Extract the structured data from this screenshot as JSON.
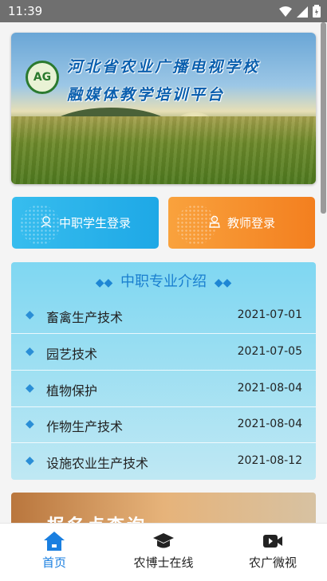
{
  "status_bar": {
    "time": "11:39"
  },
  "banner": {
    "logo_text": "AG",
    "title_line1": "河北省农业广播电视学校",
    "title_line2": "融媒体教学培训平台"
  },
  "login": {
    "student_label": "中职学生登录",
    "teacher_label": "教师登录"
  },
  "majors": {
    "header": "中职专业介绍",
    "items": [
      {
        "name": "畜禽生产技术",
        "date": "2021-07-01"
      },
      {
        "name": "园艺技术",
        "date": "2021-07-05"
      },
      {
        "name": "植物保护",
        "date": "2021-08-04"
      },
      {
        "name": "作物生产技术",
        "date": "2021-08-04"
      },
      {
        "name": "设施农业生产技术",
        "date": "2021-08-12"
      }
    ]
  },
  "promo": {
    "text": "报名点查询"
  },
  "tabbar": {
    "items": [
      {
        "label": "首页",
        "icon": "home-icon",
        "active": true
      },
      {
        "label": "农博士在线",
        "icon": "graduation-cap-icon",
        "active": false
      },
      {
        "label": "农广微视",
        "icon": "video-icon",
        "active": false
      }
    ]
  },
  "colors": {
    "accent": "#1a7fe0",
    "student_button": "#2fb4ec",
    "teacher_button": "#f59331"
  }
}
